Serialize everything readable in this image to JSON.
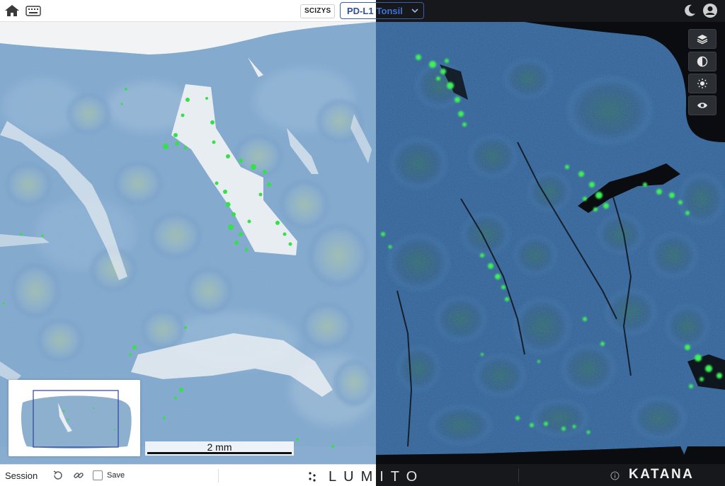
{
  "header": {
    "sciz_label": "SCIZYS",
    "marker_label": "PD-L1",
    "tissue_label": "Tonsil"
  },
  "icons": {
    "home": "home-icon",
    "keyboard": "keyboard-icon",
    "chevron": "chevron-down-icon",
    "theme": "moon-icon",
    "user": "user-avatar-icon",
    "layers": "layers-icon",
    "contrast": "contrast-icon",
    "brightness": "sun-icon",
    "visibility": "eye-icon",
    "reset": "reset-icon",
    "link": "link-icon",
    "info": "info-icon"
  },
  "scalebar": {
    "label": "2 mm"
  },
  "footer": {
    "session_label": "Session",
    "save_label": "Save",
    "brand_left": "LUMITO",
    "brand_right": "KATANA"
  },
  "colors": {
    "accent": "#3b5fa8",
    "stain_green": "#35e04a",
    "tissue_blue": "#6f9cc7",
    "dark_bg": "#16181b"
  }
}
